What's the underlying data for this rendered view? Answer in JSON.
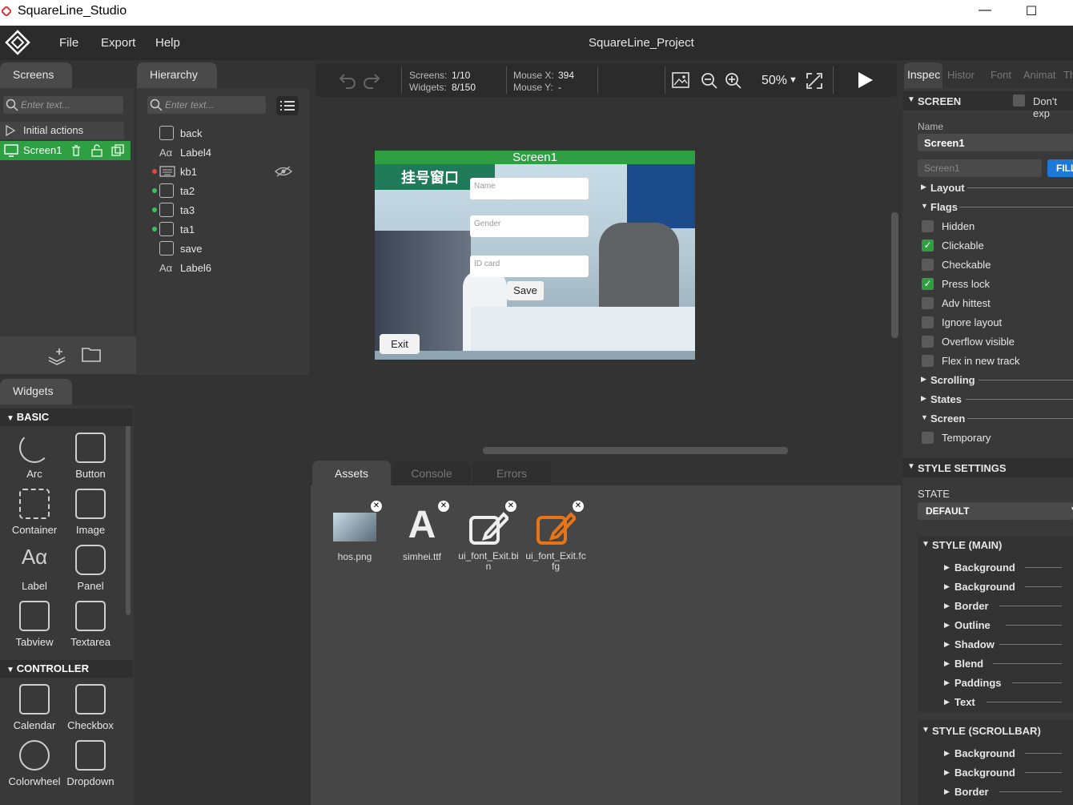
{
  "window": {
    "title": "SquareLine_Studio",
    "minimize": "—",
    "maximize": "☐"
  },
  "menu": {
    "file": "File",
    "export": "Export",
    "help": "Help",
    "project_title": "SquareLine_Project"
  },
  "screens_panel": {
    "tab": "Screens",
    "search_placeholder": "Enter text...",
    "initial_actions": "Initial actions",
    "screen_item": "Screen1"
  },
  "hierarchy_panel": {
    "tab": "Hierarchy",
    "search_placeholder": "Enter text...",
    "items": [
      "back",
      "Label4",
      "kb1",
      "ta2",
      "ta3",
      "ta1",
      "save",
      "Label6"
    ]
  },
  "toolbar": {
    "screens_label": "Screens:",
    "screens_value": "1/10",
    "widgets_label": "Widgets:",
    "widgets_value": "8/150",
    "mousex_label": "Mouse X:",
    "mousex_value": "394",
    "mousey_label": "Mouse Y:",
    "mousey_value": "-",
    "zoom": "50%"
  },
  "canvas": {
    "screen_title": "Screen1",
    "banner_text": "挂号窗口",
    "name_placeholder": "Name",
    "gender_placeholder": "Gender",
    "idcard_placeholder": "ID card",
    "save_label": "Save",
    "exit_label": "Exit"
  },
  "widgets_panel": {
    "tab": "Widgets",
    "basic_title": "BASIC",
    "basic": [
      "Arc",
      "Button",
      "Container",
      "Image",
      "Label",
      "Panel",
      "Tabview",
      "Textarea"
    ],
    "controller_title": "CONTROLLER",
    "controller": [
      "Calendar",
      "Checkbox",
      "Colorwheel",
      "Dropdown"
    ]
  },
  "bottom_tabs": {
    "assets": "Assets",
    "console": "Console",
    "errors": "Errors"
  },
  "assets": [
    "hos.png",
    "simhei.ttf",
    "ui_font_Exit.bi n",
    "ui_font_Exit.fc fg"
  ],
  "asset_letter": "A",
  "inspector": {
    "tabs": [
      "Inspec",
      "Histor",
      "Font",
      "Animat",
      "Th"
    ],
    "screen_section": "SCREEN",
    "dont_export": "Don't exp",
    "name_label": "Name",
    "name_value": "Screen1",
    "name_field_placeholder": "Screen1",
    "fill_button": "FILL",
    "layout": "Layout",
    "flags": "Flags",
    "flag_items": [
      {
        "label": "Hidden",
        "checked": false
      },
      {
        "label": "Clickable",
        "checked": true
      },
      {
        "label": "Checkable",
        "checked": false
      },
      {
        "label": "Press lock",
        "checked": true
      },
      {
        "label": "Adv hittest",
        "checked": false
      },
      {
        "label": "Ignore layout",
        "checked": false
      },
      {
        "label": "Overflow visible",
        "checked": false
      },
      {
        "label": "Flex in new track",
        "checked": false
      }
    ],
    "scrolling": "Scrolling",
    "states": "States",
    "screen_group": "Screen",
    "temporary": "Temporary",
    "style_settings": "STYLE SETTINGS",
    "state_label": "STATE",
    "state_value": "DEFAULT",
    "style_main": "STYLE (MAIN)",
    "style_main_items": [
      "Background",
      "Background",
      "Border",
      "Outline",
      "Shadow",
      "Blend",
      "Paddings",
      "Text"
    ],
    "style_scrollbar": "STYLE (SCROLLBAR)",
    "style_scrollbar_items": [
      "Background",
      "Background",
      "Border"
    ]
  },
  "colors": {
    "accent_green": "#2e9e3e",
    "fill_blue": "#1e78d6",
    "asset_orange": "#e8741a"
  }
}
